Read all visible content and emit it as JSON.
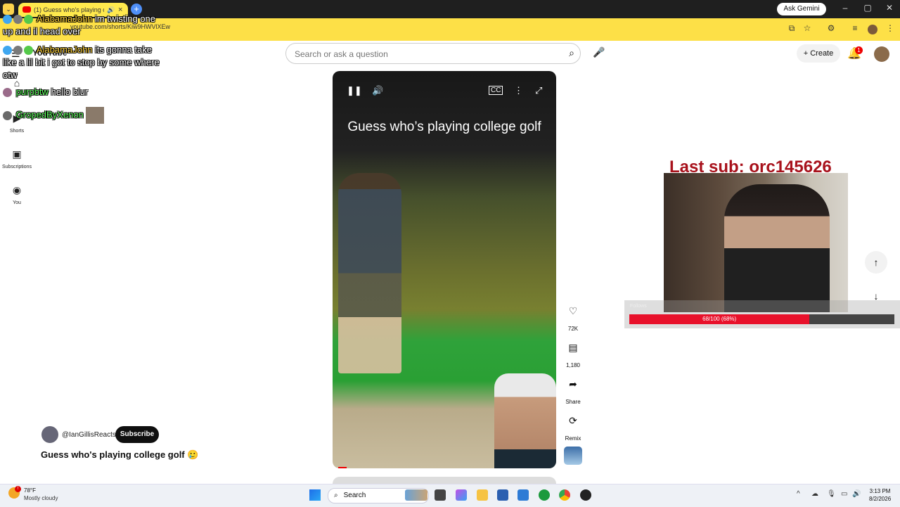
{
  "browser": {
    "tab_title": "(1) Guess who's playing coll",
    "address": "youtube.com/shorts/Kiw9HWVlXEw",
    "ask_gemini": "Ask Gemini"
  },
  "header": {
    "logo": "YouTube",
    "search_placeholder": "Search or ask a question",
    "create_label": "Create",
    "notification_count": "1"
  },
  "sidebar": {
    "items": [
      {
        "label": ""
      },
      {
        "label": "Shorts"
      },
      {
        "label": "Subscriptions"
      },
      {
        "label": "You"
      }
    ]
  },
  "chat": [
    {
      "user": "AlabamaJohn",
      "message": "im twisting one",
      "cont": "up and il head over"
    },
    {
      "user": "AlabamaJohn",
      "message": "its gonna take",
      "cont": "like a lil bit i got to stop by some where",
      "cont2": "otw"
    },
    {
      "user": "purpbtw",
      "message": "hello blur"
    },
    {
      "user": "GropedByXenon",
      "message": ""
    }
  ],
  "video": {
    "overlay_title": "Guess who’s playing college golf",
    "progress": 0.04
  },
  "actions": {
    "likes": "72K",
    "comments": "1,180",
    "share": "Share",
    "remix": "Remix"
  },
  "channel": {
    "name": "@IanGillisReacts",
    "subscribe": "Subscribe",
    "video_title": "Guess who's playing college golf 🥲"
  },
  "stream": {
    "last_sub": "Last sub: orc145626",
    "follows_label": "Follows",
    "follows_text": "68/100 (68%)",
    "follows_progress": 0.68
  },
  "taskbar": {
    "temperature": "78°F",
    "condition": "Mostly cloudy",
    "search": "Search",
    "time": "3:13 PM",
    "date": "8/2/2026"
  },
  "colors": {
    "accent": "#fde047",
    "youtube_red": "#ff0000",
    "stream_red": "#e8112b",
    "last_sub": "#a8121c"
  }
}
